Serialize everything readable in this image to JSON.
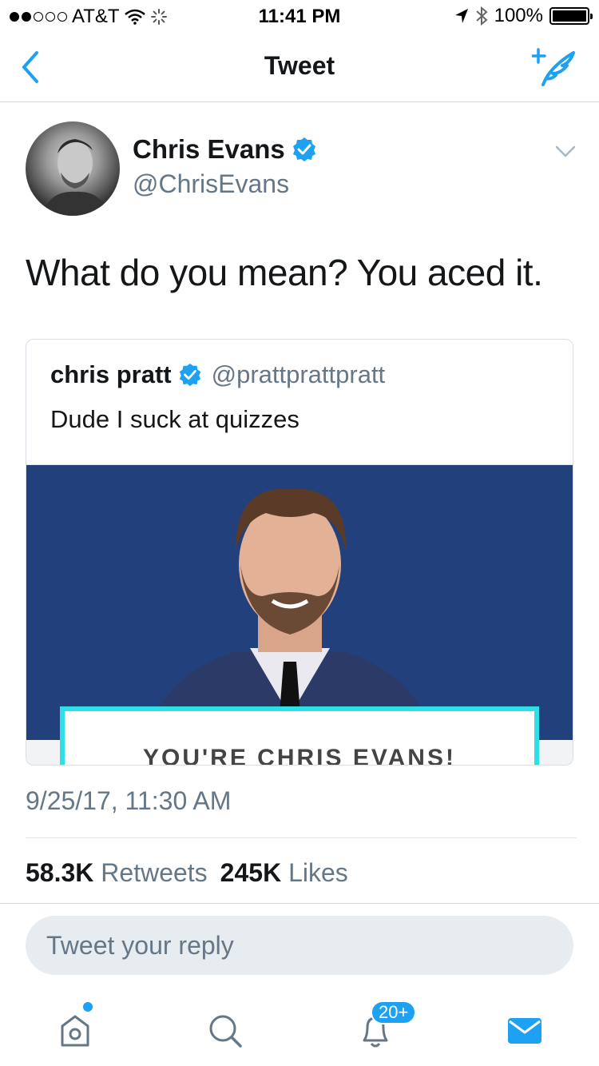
{
  "status_bar": {
    "carrier": "AT&T",
    "time": "11:41 PM",
    "battery_percent": "100%",
    "battery_level": 1.0
  },
  "nav": {
    "title": "Tweet"
  },
  "tweet": {
    "author_name": "Chris Evans",
    "author_handle": "@ChrisEvans",
    "text": "What do you mean? You aced it.",
    "timestamp": "9/25/17, 11:30 AM",
    "retweets_count": "58.3K",
    "retweets_label": "Retweets",
    "likes_count": "245K",
    "likes_label": "Likes"
  },
  "quoted_tweet": {
    "author_name": "chris pratt",
    "author_handle": "@prattprattpratt",
    "text": "Dude I suck at quizzes",
    "media_caption": "YOU'RE CHRIS EVANS!"
  },
  "reply": {
    "placeholder": "Tweet your reply"
  },
  "tab_bar": {
    "notifications_badge": "20+"
  },
  "colors": {
    "accent": "#1da1f2",
    "media_background": "#21407c",
    "result_border": "#2ee0e6"
  },
  "icons": [
    "back-chevron-icon",
    "compose-tweet-icon",
    "verified-badge-icon",
    "chevron-down-icon",
    "home-icon",
    "search-icon",
    "notifications-bell-icon",
    "messages-envelope-icon"
  ]
}
